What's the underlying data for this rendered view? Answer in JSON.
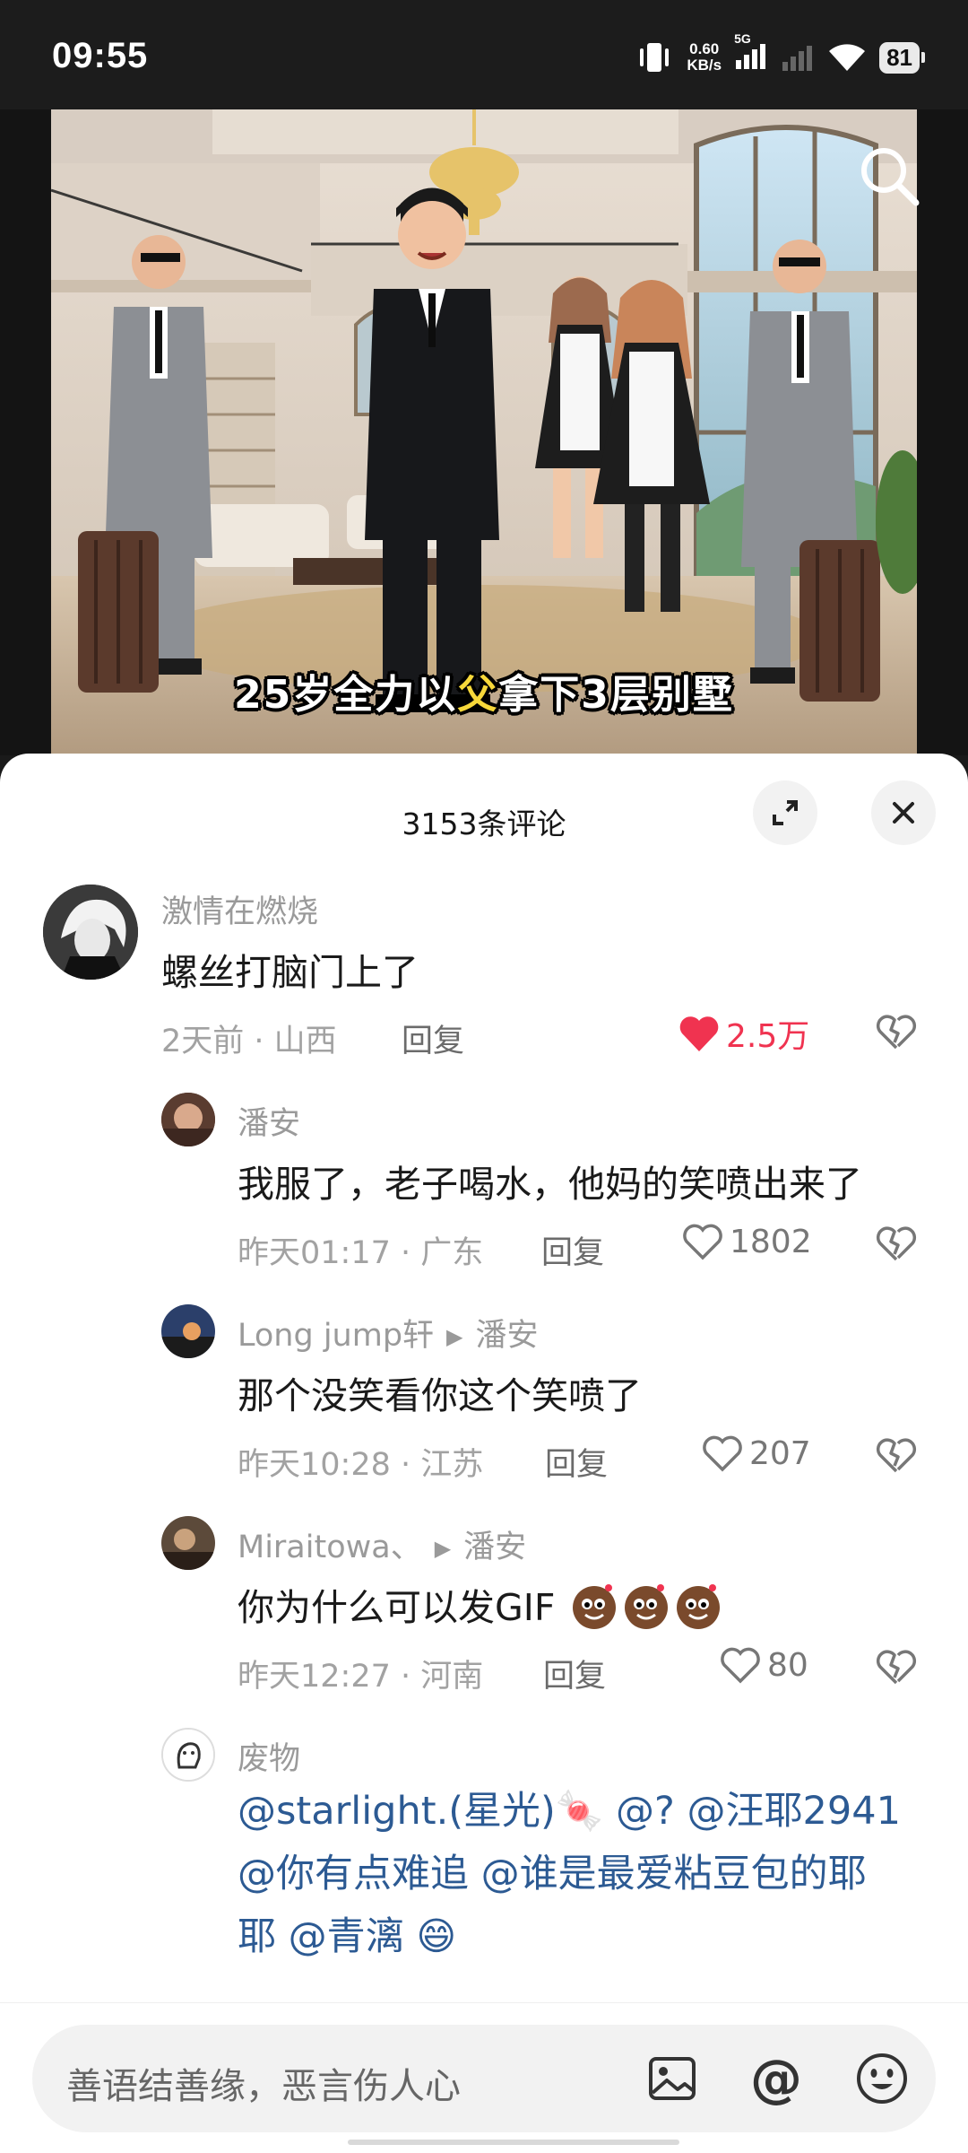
{
  "status_bar": {
    "time": "09:55",
    "net_speed_top": "0.60",
    "net_speed_unit": "KB/s",
    "network": "5G",
    "battery": "81"
  },
  "video": {
    "subtitle_before": "25岁全力以",
    "subtitle_highlight": "父",
    "subtitle_after": "拿下3层别墅",
    "search_icon": "search-icon"
  },
  "comments_panel": {
    "title": "3153条评论",
    "expand_icon": "expand-icon",
    "close_icon": "close-icon"
  },
  "comments": [
    {
      "user": "激情在燃烧",
      "text": "螺丝打脑门上了",
      "time": "2天前",
      "location": "山西",
      "reply_label": "回复",
      "likes": "2.5万",
      "liked": true
    },
    {
      "user": "潘安",
      "text": "我服了，老子喝水，他妈的笑喷出来了",
      "time": "昨天01:17",
      "location": "广东",
      "reply_label": "回复",
      "likes": "1802",
      "liked": false
    },
    {
      "user": "Long jump轩",
      "reply_to": "潘安",
      "text": "那个没笑看你这个笑喷了",
      "time": "昨天10:28",
      "location": "江苏",
      "reply_label": "回复",
      "likes": "207",
      "liked": false
    },
    {
      "user": "Miraitowa、",
      "reply_to": "潘安",
      "text": "你为什么可以发GIF",
      "time": "昨天12:27",
      "location": "河南",
      "reply_label": "回复",
      "likes": "80",
      "liked": false
    },
    {
      "user": "废物",
      "line1": "@starlight.(星光)🍬 @?  @汪耶2941",
      "line2": "@你有点难追 @谁是最爱粘豆包的耶",
      "line3": "耶 @青漓 😄"
    }
  ],
  "input": {
    "placeholder": "善语结善缘，恶言伤人心",
    "image_icon": "image-icon",
    "at_label": "@",
    "emoji_icon": "emoji-icon"
  },
  "colors": {
    "like_red": "#f03350",
    "mention_blue": "#2c5a93",
    "sheet_bg": "#ffffff"
  }
}
